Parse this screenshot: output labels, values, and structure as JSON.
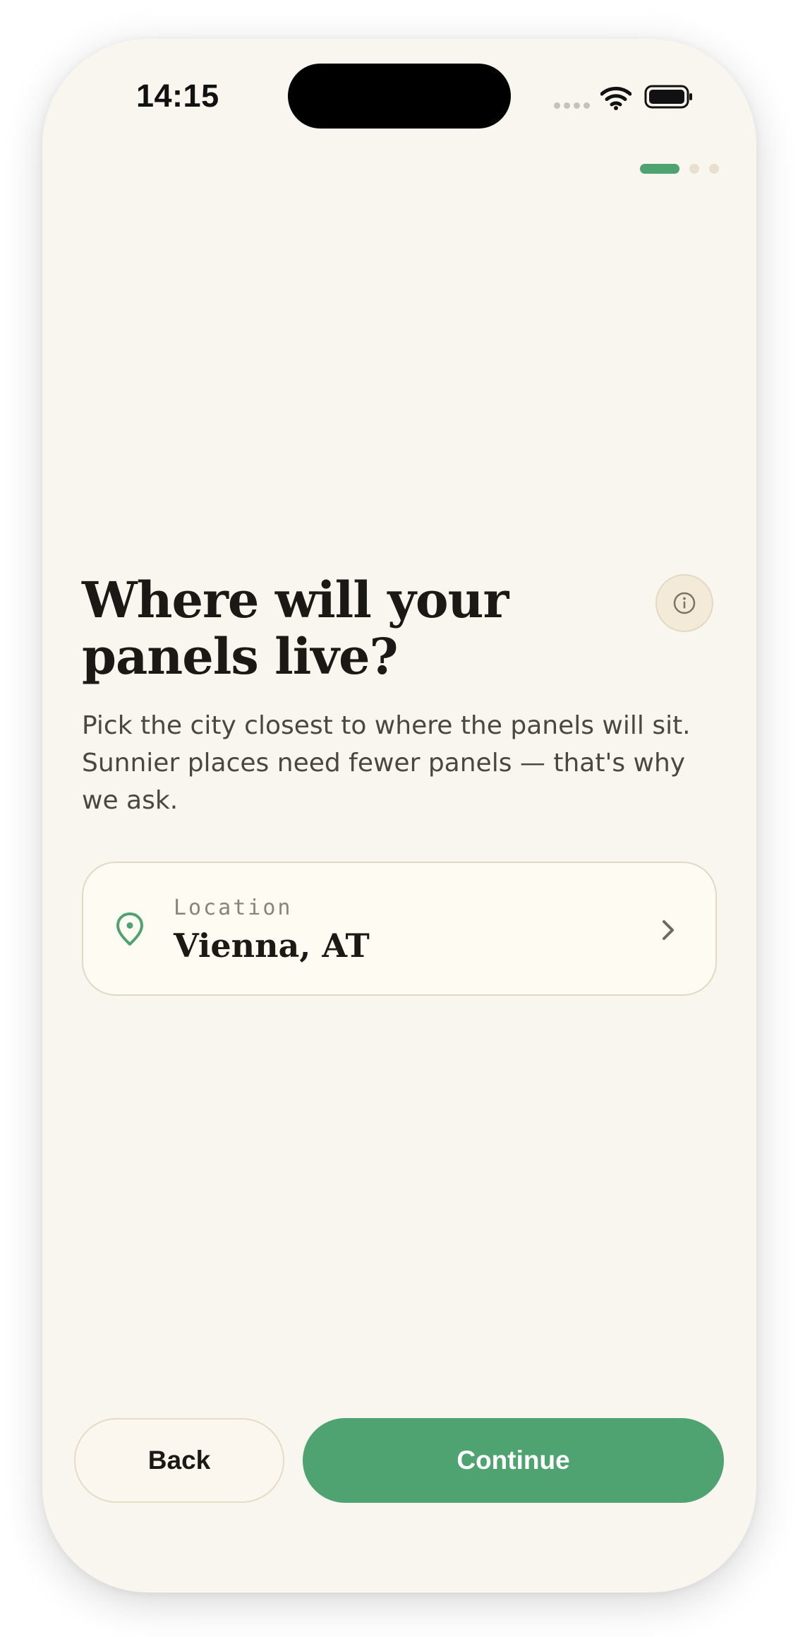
{
  "status_bar": {
    "time": "14:15",
    "icons": [
      "cellular-signal-icon",
      "wifi-icon",
      "battery-icon"
    ]
  },
  "progress": {
    "current_step": 1,
    "total_steps": 3
  },
  "main": {
    "headline": "Where will your panels live?",
    "subtitle": "Pick the city closest to where the panels will sit. Sunnier places need fewer panels — that's why we ask.",
    "info_icon": "info-icon"
  },
  "location_card": {
    "label": "Location",
    "value": "Vienna, AT",
    "icon": "map-pin-icon",
    "trailing_icon": "chevron-right-icon"
  },
  "footer": {
    "back_label": "Back",
    "continue_label": "Continue"
  },
  "colors": {
    "background": "#f9f5ef",
    "accent": "#4fa371",
    "card": "#fefbf3",
    "border": "#e2d9c4",
    "text": "#1b1915",
    "muted": "#4a4741"
  }
}
